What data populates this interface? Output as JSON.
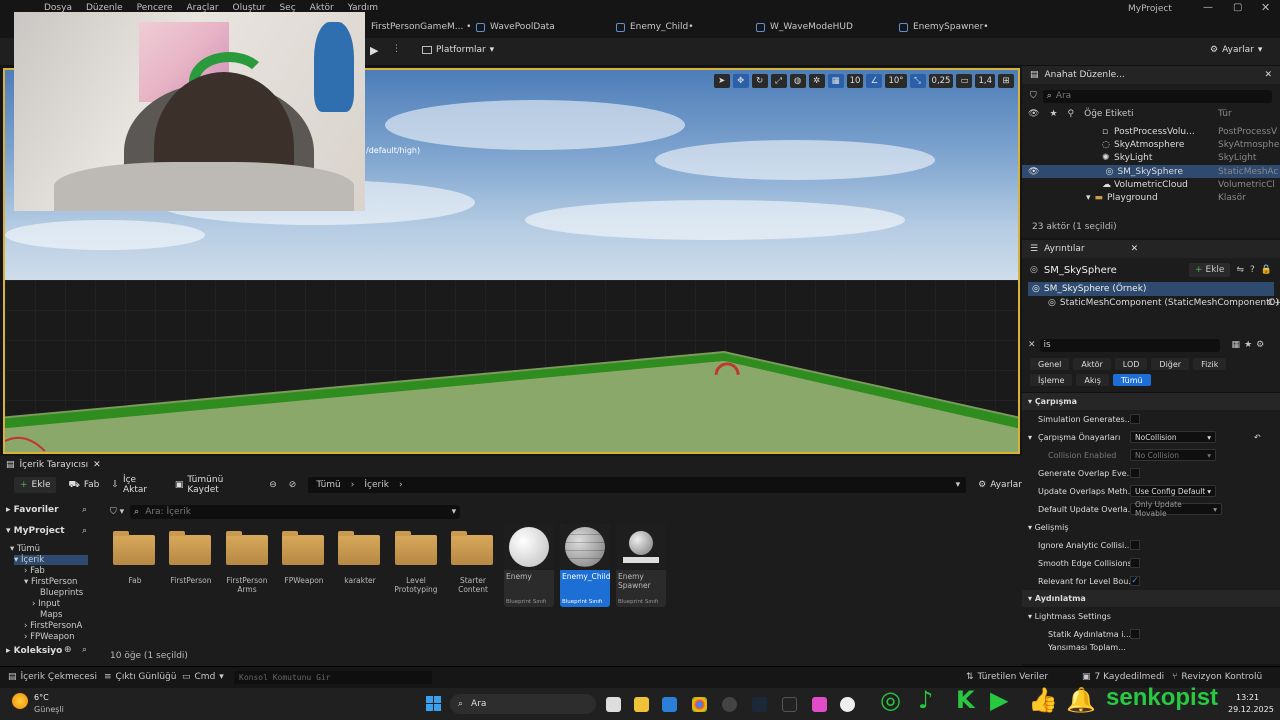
{
  "menu": [
    "Dosya",
    "Düzenle",
    "Pencere",
    "Araçlar",
    "Oluştur",
    "Seç",
    "Aktör",
    "Yardım"
  ],
  "project_name": "MyProject",
  "doc_tabs": [
    {
      "label": "FirstPersonGameM... •"
    },
    {
      "label": "WavePoolData"
    },
    {
      "label": "Enemy_Child•"
    },
    {
      "label": "W_WaveModeHUD"
    },
    {
      "label": "EnemySpawner•"
    }
  ],
  "toolbar": {
    "platforms": "Platformlar",
    "settings": "Ayarlar"
  },
  "viewport": {
    "overlay_text": "/default/high)",
    "grid_snap": "10",
    "rot_snap": "10°",
    "scale_snap": "0,25",
    "cam_speed": "1,4"
  },
  "outliner": {
    "title": "Anahat Düzenle...",
    "search_placeholder": "Ara",
    "col_label": "Öğe Etiketi",
    "col_type": "Tür",
    "rows": [
      {
        "name": "PostProcessVolu...",
        "type": "PostProcessV"
      },
      {
        "name": "SkyAtmosphere",
        "type": "SkyAtmosphe"
      },
      {
        "name": "SkyLight",
        "type": "SkyLight"
      },
      {
        "name": "SM_SkySphere",
        "type": "StaticMeshAc"
      },
      {
        "name": "VolumetricCloud",
        "type": "VolumetricCl"
      },
      {
        "name": "Playground",
        "type": "Klasör"
      }
    ],
    "count": "23 aktör (1 seçildi)"
  },
  "details": {
    "title": "Ayrıntılar",
    "object": "SM_SkySphere",
    "add_label": "Ekle",
    "instance": "SM_SkySphere (Örnek)",
    "component": "StaticMeshComponent (StaticMeshComponent0)",
    "component_lang": "C++",
    "search_value": "is",
    "filters": [
      "Genel",
      "Aktör",
      "LOD",
      "Diğer",
      "Fizik",
      "İşleme",
      "Akış",
      "Tümü"
    ],
    "cat_collision": "Çarpışma",
    "props_collision": [
      {
        "label": "Simulation Generates..."
      },
      {
        "label": "Çarpışma Önayarları",
        "value": "NoCollision"
      },
      {
        "label": "Collision Enabled",
        "value": "No Collision"
      },
      {
        "label": "Generate Overlap Eve..."
      },
      {
        "label": "Update Overlaps Meth...",
        "value": "Use Config Default"
      },
      {
        "label": "Default Update Overla...",
        "value": "Only Update Movable"
      }
    ],
    "cat_advanced": "Gelişmiş",
    "props_advanced": [
      {
        "label": "Ignore Analytic Collisi..."
      },
      {
        "label": "Smooth Edge Collisions"
      },
      {
        "label": "Relevant for Level Bou..."
      }
    ],
    "cat_lighting": "Aydınlatma",
    "lightmass": "Lightmass Settings",
    "props_light": [
      {
        "label": "Statik Aydınlatma i..."
      },
      {
        "label": "Yansıması Toplam..."
      }
    ]
  },
  "content": {
    "tab_title": "İçerik Tarayıcısı",
    "add": "Ekle",
    "fab": "Fab",
    "import": "İçe Aktar",
    "save_all": "Tümünü Kaydet",
    "path": [
      "Tümü",
      "İçerik"
    ],
    "settings": "Ayarlar",
    "favorites": "Favoriler",
    "project": "MyProject",
    "search_placeholder": "Ara: İçerik",
    "tree": [
      {
        "label": "Tümü",
        "indent": 0
      },
      {
        "label": "İçerik",
        "indent": 1
      },
      {
        "label": "Fab",
        "indent": 2
      },
      {
        "label": "FirstPerson",
        "indent": 2
      },
      {
        "label": "Blueprints",
        "indent": 3
      },
      {
        "label": "Input",
        "indent": 3
      },
      {
        "label": "Maps",
        "indent": 3
      },
      {
        "label": "FirstPersonA",
        "indent": 2
      },
      {
        "label": "FPWeapon",
        "indent": 2
      }
    ],
    "collections": "Koleksiyo",
    "folders": [
      "Fab",
      "FirstPerson",
      "FirstPerson Arms",
      "FPWeapon",
      "karakter",
      "Level Prototyping",
      "Starter Content"
    ],
    "assets": [
      {
        "name": "Enemy",
        "kind": "Blueprint Sınıfı"
      },
      {
        "name": "Enemy_Child",
        "kind": "Blueprint Sınıfı"
      },
      {
        "name": "Enemy Spawner",
        "kind": "Blueprint Sınıfı"
      }
    ],
    "count": "10 öğe (1 seçildi)"
  },
  "statusbar": {
    "drawer": "İçerik Çekmecesi",
    "output": "Çıktı Günlüğü",
    "cmd": "Cmd",
    "console_placeholder": "Konsol Komutunu Gir",
    "derived": "Türetilen Veriler",
    "unsaved": "7 Kaydedilmedi",
    "revision": "Revizyon Kontrolü"
  },
  "taskbar": {
    "weather_temp": "6°C",
    "weather_desc": "Güneşli",
    "search": "Ara",
    "brand": "senkopist",
    "time": "13:21",
    "date": "29.12.2025"
  }
}
